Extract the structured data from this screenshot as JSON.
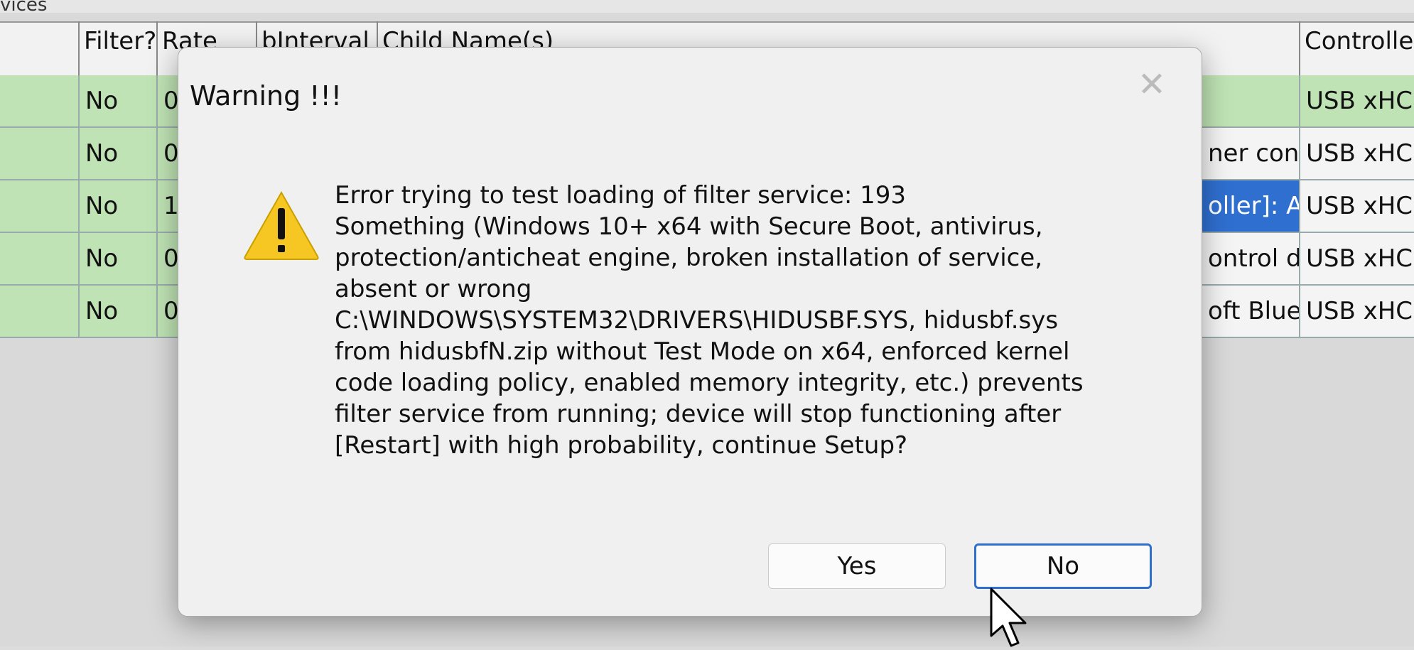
{
  "background": {
    "window_title_fragment": "vices",
    "columns": {
      "filter": "Filter?",
      "rate": "Rate",
      "interval": "bInterval",
      "child_names": "Child Name(s)",
      "controller": "Controller"
    },
    "rows": [
      {
        "filter": "No",
        "rate": "0",
        "child": "",
        "controller": "USB xHC"
      },
      {
        "filter": "No",
        "rate": "0",
        "child": "ner conl",
        "controller": "USB xHC"
      },
      {
        "filter": "No",
        "rate": "1",
        "child": "oller]: Al",
        "controller": "USB xHC"
      },
      {
        "filter": "No",
        "rate": "0",
        "child": "ontrol d",
        "controller": "USB xHC"
      },
      {
        "filter": "No",
        "rate": "0",
        "child": "oft Bluel",
        "controller": "USB xHC"
      }
    ]
  },
  "dialog": {
    "title": "Warning !!!",
    "close_symbol": "✕",
    "icon": "warning-triangle-icon",
    "message_lines": [
      "Error trying to test loading of filter service: 193",
      "Something (Windows 10+ x64 with Secure Boot, antivirus,",
      "protection/anticheat engine, broken installation of service,",
      "absent or wrong",
      "C:\\WINDOWS\\SYSTEM32\\DRIVERS\\HIDUSBF.SYS, hidusbf.sys",
      "from hidusbfN.zip without Test Mode on x64, enforced kernel",
      "code loading policy, enabled memory integrity, etc.) prevents",
      "filter service from running; device will stop functioning after",
      "[Restart] with high probability, continue Setup?"
    ],
    "buttons": {
      "yes": "Yes",
      "no": "No"
    }
  },
  "colors": {
    "row_green": "#bfe3b4",
    "selection_blue": "#2f6fd0",
    "dialog_bg": "#f0f0f0",
    "warning_yellow": "#f6c623"
  }
}
